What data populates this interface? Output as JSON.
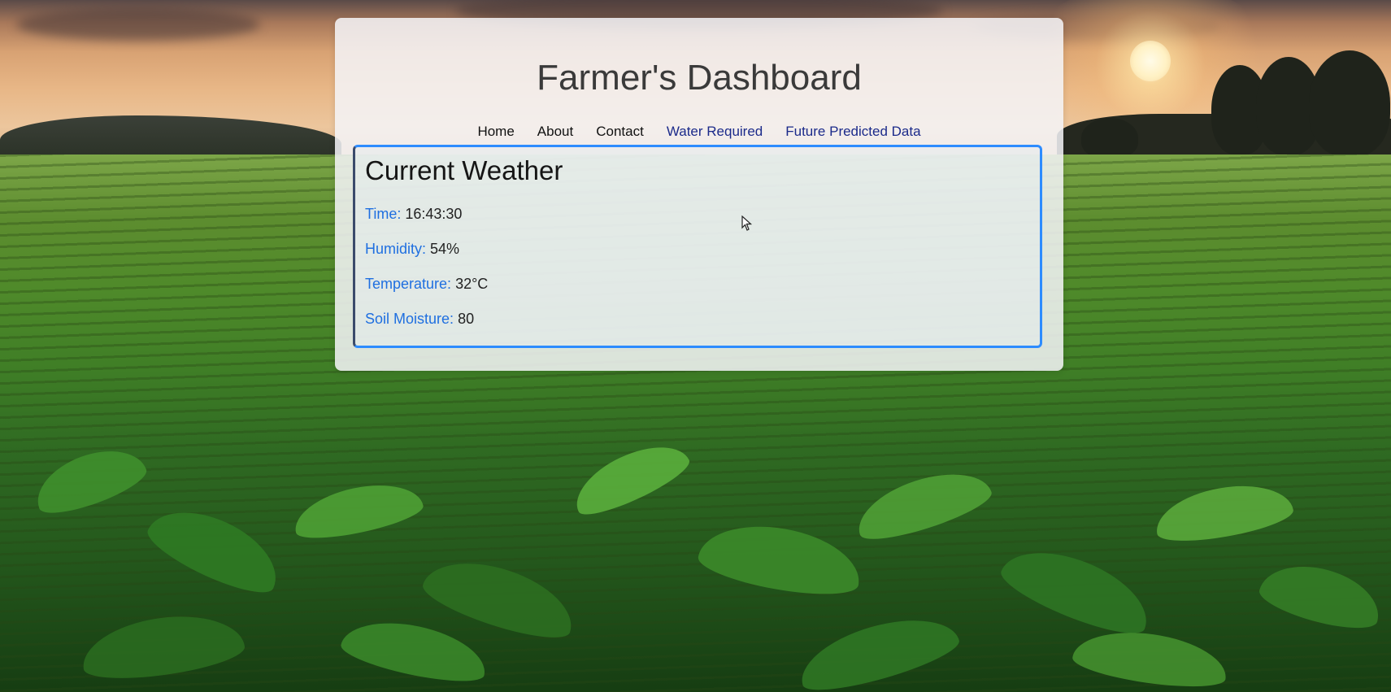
{
  "header": {
    "title": "Farmer's Dashboard"
  },
  "nav": {
    "items": [
      {
        "label": "Home"
      },
      {
        "label": "About"
      },
      {
        "label": "Contact"
      },
      {
        "label": "Water Required"
      },
      {
        "label": "Future Predicted Data"
      }
    ]
  },
  "weather": {
    "title": "Current Weather",
    "time_label": "Time:",
    "time_value": "16:43:30",
    "humidity_label": "Humidity:",
    "humidity_value": "54%",
    "temperature_label": "Temperature:",
    "temperature_value": "32°C",
    "soil_label": "Soil Moisture:",
    "soil_value": "80"
  },
  "colors": {
    "accent": "#2d8cff",
    "label": "#1f6fe0",
    "panel": "#f4f4f8"
  }
}
